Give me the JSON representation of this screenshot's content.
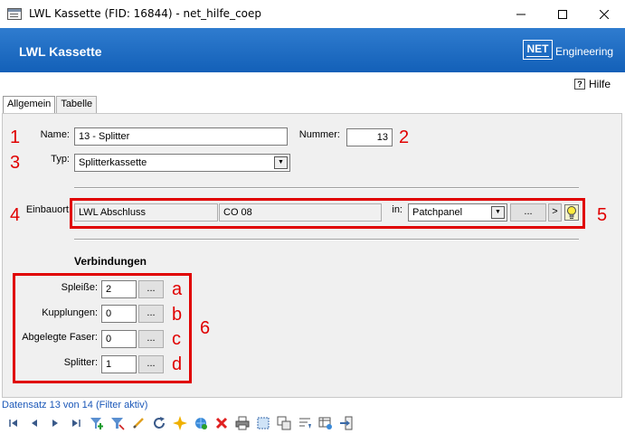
{
  "window": {
    "title": "LWL Kassette (FID: 16844) - net_hilfe_coep"
  },
  "header": {
    "title": "LWL Kassette",
    "logo_mark": "NET",
    "logo_text": "Engineering"
  },
  "help": {
    "label": "Hilfe"
  },
  "tabs": [
    {
      "label": "Allgemein",
      "active": true
    },
    {
      "label": "Tabelle",
      "active": false
    }
  ],
  "form": {
    "name_label": "Name:",
    "name_value": "13 - Splitter",
    "nummer_label": "Nummer:",
    "nummer_value": "13",
    "typ_label": "Typ:",
    "typ_value": "Splitterkassette",
    "einbauort_label": "Einbauort:",
    "einbauort_value1": "LWL Abschluss",
    "einbauort_value2": "CO 08",
    "in_label": "in:",
    "in_value": "Patchpanel",
    "browse_label": "...",
    "goto_label": ">"
  },
  "verbindungen": {
    "title": "Verbindungen",
    "rows": [
      {
        "label": "Spleiße:",
        "value": "2",
        "button": "...",
        "annot": "a"
      },
      {
        "label": "Kupplungen:",
        "value": "0",
        "button": "...",
        "annot": "b"
      },
      {
        "label": "Abgelegte Faser:",
        "value": "0",
        "button": "...",
        "annot": "c"
      },
      {
        "label": "Splitter:",
        "value": "1",
        "button": "...",
        "annot": "d"
      }
    ]
  },
  "annotations": {
    "n1": "1",
    "n2": "2",
    "n3": "3",
    "n4": "4",
    "n5": "5",
    "n6": "6",
    "color": "#e00000"
  },
  "status": {
    "text": "Datensatz 13 von 14 (Filter aktiv)"
  },
  "colors": {
    "header_blue": "#1a6ac4",
    "status_blue": "#1a57b8"
  }
}
